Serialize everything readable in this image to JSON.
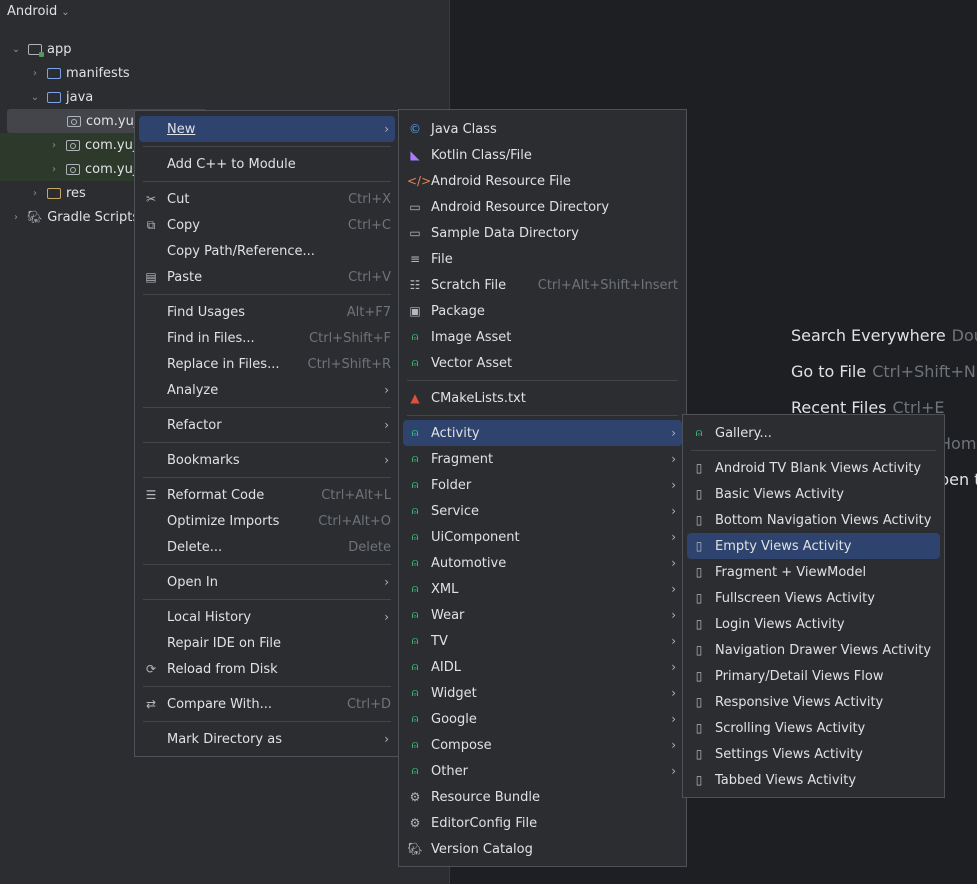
{
  "project_panel": {
    "view_selector": "Android",
    "tree": [
      {
        "label": "app",
        "icon": "module-folder-icon"
      },
      {
        "label": "manifests",
        "icon": "folder-icon"
      },
      {
        "label": "java",
        "icon": "folder-icon"
      },
      {
        "label": "com.yuj",
        "icon": "package-icon"
      },
      {
        "label": "com.yuj",
        "icon": "package-icon"
      },
      {
        "label": "com.yuj",
        "icon": "package-icon"
      },
      {
        "label": "res",
        "icon": "res-folder-icon"
      },
      {
        "label": "Gradle Scripts",
        "icon": "gradle-icon"
      }
    ]
  },
  "editor_hints": [
    {
      "label": "Search Everywhere",
      "key": "Dou"
    },
    {
      "label": "Go to File",
      "key": "Ctrl+Shift+N"
    },
    {
      "label": "Recent Files",
      "key": "Ctrl+E"
    },
    {
      "label": "",
      "key": "Hom"
    },
    {
      "label": "",
      "key": "pen t"
    }
  ],
  "context_menu": [
    {
      "label": "New"
    },
    {
      "label": "Add C++ to Module"
    },
    {
      "label": "Cut",
      "shortcut": "Ctrl+X"
    },
    {
      "label": "Copy",
      "shortcut": "Ctrl+C"
    },
    {
      "label": "Copy Path/Reference..."
    },
    {
      "label": "Paste",
      "shortcut": "Ctrl+V"
    },
    {
      "label": "Find Usages",
      "shortcut": "Alt+F7"
    },
    {
      "label": "Find in Files...",
      "shortcut": "Ctrl+Shift+F"
    },
    {
      "label": "Replace in Files...",
      "shortcut": "Ctrl+Shift+R"
    },
    {
      "label": "Analyze"
    },
    {
      "label": "Refactor"
    },
    {
      "label": "Bookmarks"
    },
    {
      "label": "Reformat Code",
      "shortcut": "Ctrl+Alt+L"
    },
    {
      "label": "Optimize Imports",
      "shortcut": "Ctrl+Alt+O"
    },
    {
      "label": "Delete...",
      "shortcut": "Delete"
    },
    {
      "label": "Open In"
    },
    {
      "label": "Local History"
    },
    {
      "label": "Repair IDE on File"
    },
    {
      "label": "Reload from Disk"
    },
    {
      "label": "Compare With...",
      "shortcut": "Ctrl+D"
    },
    {
      "label": "Mark Directory as"
    }
  ],
  "new_menu": [
    {
      "label": "Java Class"
    },
    {
      "label": "Kotlin Class/File"
    },
    {
      "label": "Android Resource File"
    },
    {
      "label": "Android Resource Directory"
    },
    {
      "label": "Sample Data Directory"
    },
    {
      "label": "File"
    },
    {
      "label": "Scratch File",
      "shortcut": "Ctrl+Alt+Shift+Insert"
    },
    {
      "label": "Package"
    },
    {
      "label": "Image Asset"
    },
    {
      "label": "Vector Asset"
    },
    {
      "label": "CMakeLists.txt"
    },
    {
      "label": "Activity"
    },
    {
      "label": "Fragment"
    },
    {
      "label": "Folder"
    },
    {
      "label": "Service"
    },
    {
      "label": "UiComponent"
    },
    {
      "label": "Automotive"
    },
    {
      "label": "XML"
    },
    {
      "label": "Wear"
    },
    {
      "label": "TV"
    },
    {
      "label": "AIDL"
    },
    {
      "label": "Widget"
    },
    {
      "label": "Google"
    },
    {
      "label": "Compose"
    },
    {
      "label": "Other"
    },
    {
      "label": "Resource Bundle"
    },
    {
      "label": "EditorConfig File"
    },
    {
      "label": "Version Catalog"
    }
  ],
  "activity_menu": [
    {
      "label": "Gallery..."
    },
    {
      "label": "Android TV Blank Views Activity"
    },
    {
      "label": "Basic Views Activity"
    },
    {
      "label": "Bottom Navigation Views Activity"
    },
    {
      "label": "Empty Views Activity"
    },
    {
      "label": "Fragment + ViewModel"
    },
    {
      "label": "Fullscreen Views Activity"
    },
    {
      "label": "Login Views Activity"
    },
    {
      "label": "Navigation Drawer Views Activity"
    },
    {
      "label": "Primary/Detail Views Flow"
    },
    {
      "label": "Responsive Views Activity"
    },
    {
      "label": "Scrolling Views Activity"
    },
    {
      "label": "Settings Views Activity"
    },
    {
      "label": "Tabbed Views Activity"
    }
  ]
}
